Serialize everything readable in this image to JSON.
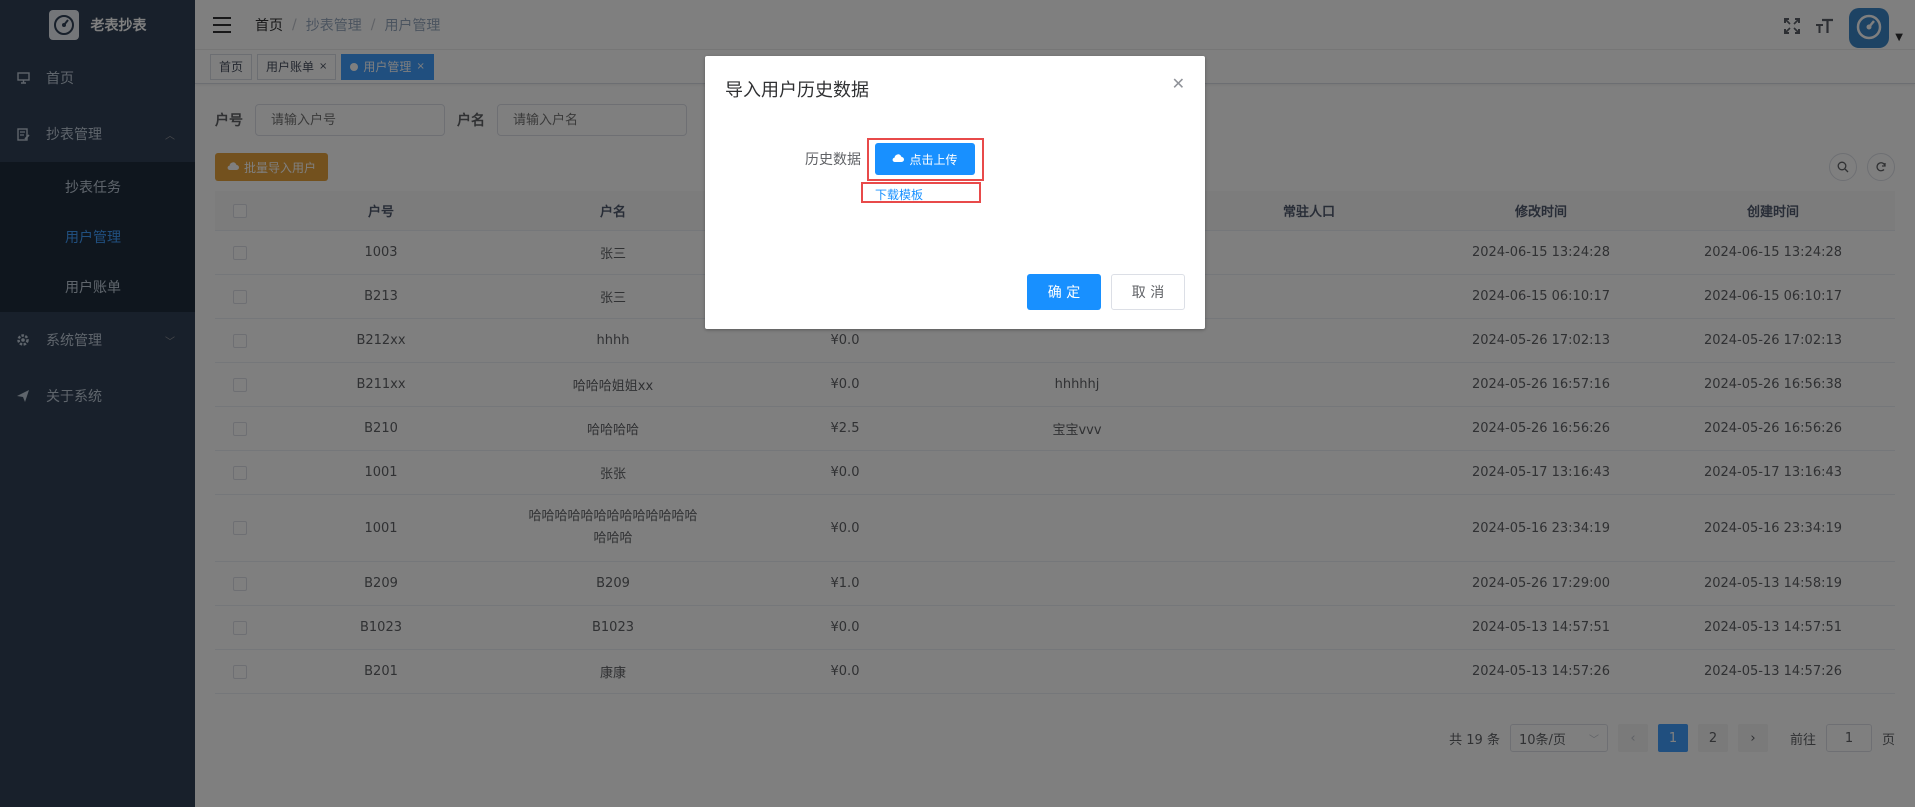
{
  "app": {
    "title": "老表抄表"
  },
  "sidebar": {
    "items": [
      {
        "label": "首页"
      },
      {
        "label": "抄表管理"
      },
      {
        "label": "系统管理"
      },
      {
        "label": "关于系统"
      }
    ],
    "sub_items": [
      {
        "label": "抄表任务"
      },
      {
        "label": "用户管理"
      },
      {
        "label": "用户账单"
      }
    ]
  },
  "breadcrumb": [
    "首页",
    "抄表管理",
    "用户管理"
  ],
  "tags": [
    {
      "label": "首页"
    },
    {
      "label": "用户账单"
    },
    {
      "label": "用户管理"
    }
  ],
  "search": {
    "account_label": "户号",
    "account_placeholder": "请输入户号",
    "name_label": "户名",
    "name_placeholder": "请输入户名"
  },
  "toolbar": {
    "import_label": "批量导入用户"
  },
  "table": {
    "columns": [
      "户号",
      "户名",
      "",
      "",
      "常驻人口",
      "修改时间",
      "创建时间"
    ],
    "rows": [
      {
        "account": "1003",
        "name": "张三",
        "balance": "",
        "note": "",
        "modified": "2024-06-15 13:24:28",
        "created": "2024-06-15 13:24:28"
      },
      {
        "account": "B213",
        "name": "张三",
        "balance": "",
        "note": "",
        "modified": "2024-06-15 06:10:17",
        "created": "2024-06-15 06:10:17"
      },
      {
        "account": "B212xx",
        "name": "hhhh",
        "balance": "¥0.0",
        "note": "",
        "modified": "2024-05-26 17:02:13",
        "created": "2024-05-26 17:02:13"
      },
      {
        "account": "B211xx",
        "name": "哈哈哈姐姐xx",
        "balance": "¥0.0",
        "note": "hhhhhj",
        "modified": "2024-05-26 16:57:16",
        "created": "2024-05-26 16:56:38"
      },
      {
        "account": "B210",
        "name": "哈哈哈哈",
        "balance": "¥2.5",
        "note": "宝宝vvv",
        "modified": "2024-05-26 16:56:26",
        "created": "2024-05-26 16:56:26"
      },
      {
        "account": "1001",
        "name": "张张",
        "balance": "¥0.0",
        "note": "",
        "modified": "2024-05-17 13:16:43",
        "created": "2024-05-17 13:16:43"
      },
      {
        "account": "1001",
        "name": "哈哈哈哈哈哈哈哈哈哈哈哈哈哈哈哈",
        "balance": "¥0.0",
        "note": "",
        "modified": "2024-05-16 23:34:19",
        "created": "2024-05-16 23:34:19"
      },
      {
        "account": "B209",
        "name": "B209",
        "balance": "¥1.0",
        "note": "",
        "modified": "2024-05-26 17:29:00",
        "created": "2024-05-13 14:58:19"
      },
      {
        "account": "B1023",
        "name": "B1023",
        "balance": "¥0.0",
        "note": "",
        "modified": "2024-05-13 14:57:51",
        "created": "2024-05-13 14:57:51"
      },
      {
        "account": "B201",
        "name": "康康",
        "balance": "¥0.0",
        "note": "",
        "modified": "2024-05-13 14:57:26",
        "created": "2024-05-13 14:57:26"
      }
    ]
  },
  "pagination": {
    "total": "共 19 条",
    "page_size": "10条/页",
    "pages": [
      "1",
      "2"
    ],
    "current": "1",
    "goto_label": "前往",
    "goto_value": "1",
    "page_unit": "页"
  },
  "dialog": {
    "title": "导入用户历史数据",
    "field_label": "历史数据",
    "upload_label": "点击上传",
    "download_label": "下载模板",
    "ok_label": "确 定",
    "cancel_label": "取 消"
  },
  "colors": {
    "sidebar_bg": "#304156",
    "submenu_bg": "#1f2d3d",
    "primary": "#1890ff",
    "warning": "#e6a23c",
    "highlight_box": "#e84a4a"
  }
}
